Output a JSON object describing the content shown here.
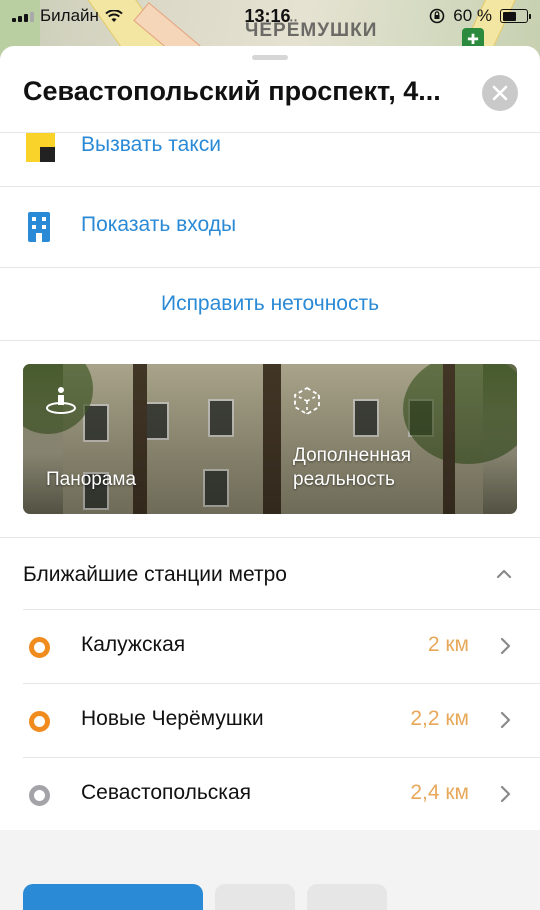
{
  "status_bar": {
    "carrier": "Билайн",
    "time": "13:16",
    "battery_text": "60 %",
    "battery_level": 0.6
  },
  "map": {
    "district_label": "ЧЕРЁМУШКИ"
  },
  "sheet": {
    "title": "Севастопольский проспект, 4...",
    "actions": [
      {
        "label": "Вызвать такси",
        "icon": "taxi-icon"
      },
      {
        "label": "Показать входы",
        "icon": "building-entrances-icon"
      }
    ],
    "fix_link": "Исправить неточность",
    "photo_actions": [
      {
        "label": "Панорама",
        "icon": "panorama-icon"
      },
      {
        "label_line1": "Дополненная",
        "label_line2": "реальность",
        "icon": "ar-cube-icon"
      }
    ],
    "metro_section": {
      "title": "Ближайшие станции метро",
      "stations": [
        {
          "name": "Калужская",
          "distance": "2 км",
          "color": "#f08c1e"
        },
        {
          "name": "Новые Черёмушки",
          "distance": "2,2 км",
          "color": "#f08c1e"
        },
        {
          "name": "Севастопольская",
          "distance": "2,4 км",
          "color": "#a3a3a8"
        }
      ]
    }
  },
  "colors": {
    "accent": "#2a8ad6",
    "distance": "#e8a85a"
  }
}
